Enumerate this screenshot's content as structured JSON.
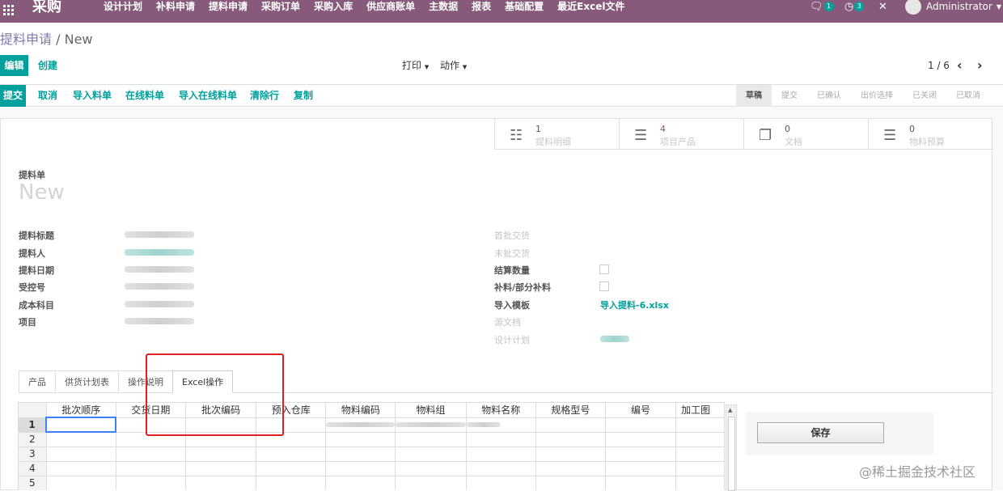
{
  "navbar": {
    "app_title": "采购",
    "menu": [
      "设计计划",
      "补料申请",
      "提料申请",
      "采购订单",
      "采购入库",
      "供应商账单",
      "主数据",
      "报表",
      "基础配置",
      "最近Excel文件"
    ],
    "chat_count": "1",
    "activity_count": "3",
    "user": "Administrator",
    "color": "#875a7b"
  },
  "breadcrumb": {
    "parent": "提料申请",
    "sep": "/",
    "current": "New"
  },
  "control": {
    "edit": "编辑",
    "create": "创建",
    "print": "打印",
    "action": "动作",
    "pager": "1 / 6"
  },
  "actions": [
    "提交",
    "取消",
    "导入料单",
    "在线料单",
    "导入在线料单",
    "清除行",
    "复制"
  ],
  "steps": [
    "草稿",
    "提交",
    "已确认",
    "出价选择",
    "已关闭",
    "已取消"
  ],
  "smart_buttons": [
    {
      "count": "1",
      "label": "提料明细",
      "icon": "sitemap-icon"
    },
    {
      "count": "4",
      "label": "项目产品",
      "icon": "list-icon"
    },
    {
      "count": "0",
      "label": "文档",
      "icon": "files-icon"
    },
    {
      "count": "0",
      "label": "物料预算",
      "icon": "list-icon"
    }
  ],
  "form": {
    "caption": "提料单",
    "name": "New",
    "left_labels": [
      "提料标题",
      "提料人",
      "提料日期",
      "受控号",
      "成本科目",
      "项目"
    ],
    "right_labels": [
      "首批交货",
      "末批交货",
      "结算数量",
      "补料/部分补料",
      "导入模板",
      "源文档",
      "设计计划"
    ],
    "template_file": "导入提料-6.xlsx"
  },
  "tabs": [
    "产品",
    "供货计划表",
    "操作说明",
    "Excel操作"
  ],
  "sheet": {
    "headers": [
      "批次顺序",
      "交货日期",
      "批次编码",
      "预入仓库",
      "物料编码",
      "物料组",
      "物料名称",
      "规格型号",
      "编号",
      "加工图"
    ],
    "rows": [
      "1",
      "2",
      "3",
      "4",
      "5"
    ]
  },
  "save_label": "保存",
  "watermark": "@稀土掘金技术社区",
  "accent": "#00a09d"
}
